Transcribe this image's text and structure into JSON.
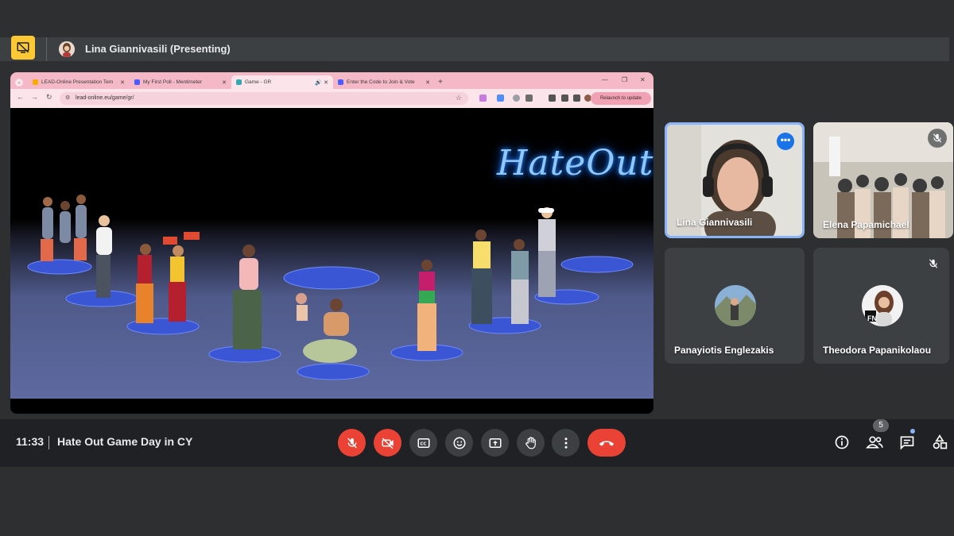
{
  "presenter": {
    "name": "Lina Giannivasili (Presenting)"
  },
  "browser": {
    "tabs": [
      {
        "label": "LEAD-Online Presentation Tem",
        "favicon_color": "#f9ab00"
      },
      {
        "label": "My First Poll - Mentimeter",
        "favicon_color": "#4a5bff"
      },
      {
        "label": "Game - GR",
        "favicon_color": "#34a7b5"
      },
      {
        "label": "Enter the Code to Join & Vote",
        "favicon_color": "#4a5bff"
      }
    ],
    "url": "lead-online.eu/game/gr/",
    "relaunch_label": "Relaunch to update"
  },
  "game": {
    "logo_text": "HateOut!"
  },
  "participants": [
    {
      "name": "Lina Giannivasili",
      "speaking": true,
      "menu_icon": "more-horizontal-icon"
    },
    {
      "name": "Elena Papamichael",
      "muted": true
    },
    {
      "name": "Panayiotis Englezakis"
    },
    {
      "name": "Theodora Papanikolaou",
      "muted": true,
      "avatar_text": "FN"
    }
  ],
  "bottom": {
    "time": "11:33",
    "meeting_title": "Hate Out Game Day in CY",
    "people_count": "5"
  },
  "colors": {
    "accent": "#8ab4f8",
    "danger": "#ea4335",
    "present": "#fcc934"
  }
}
